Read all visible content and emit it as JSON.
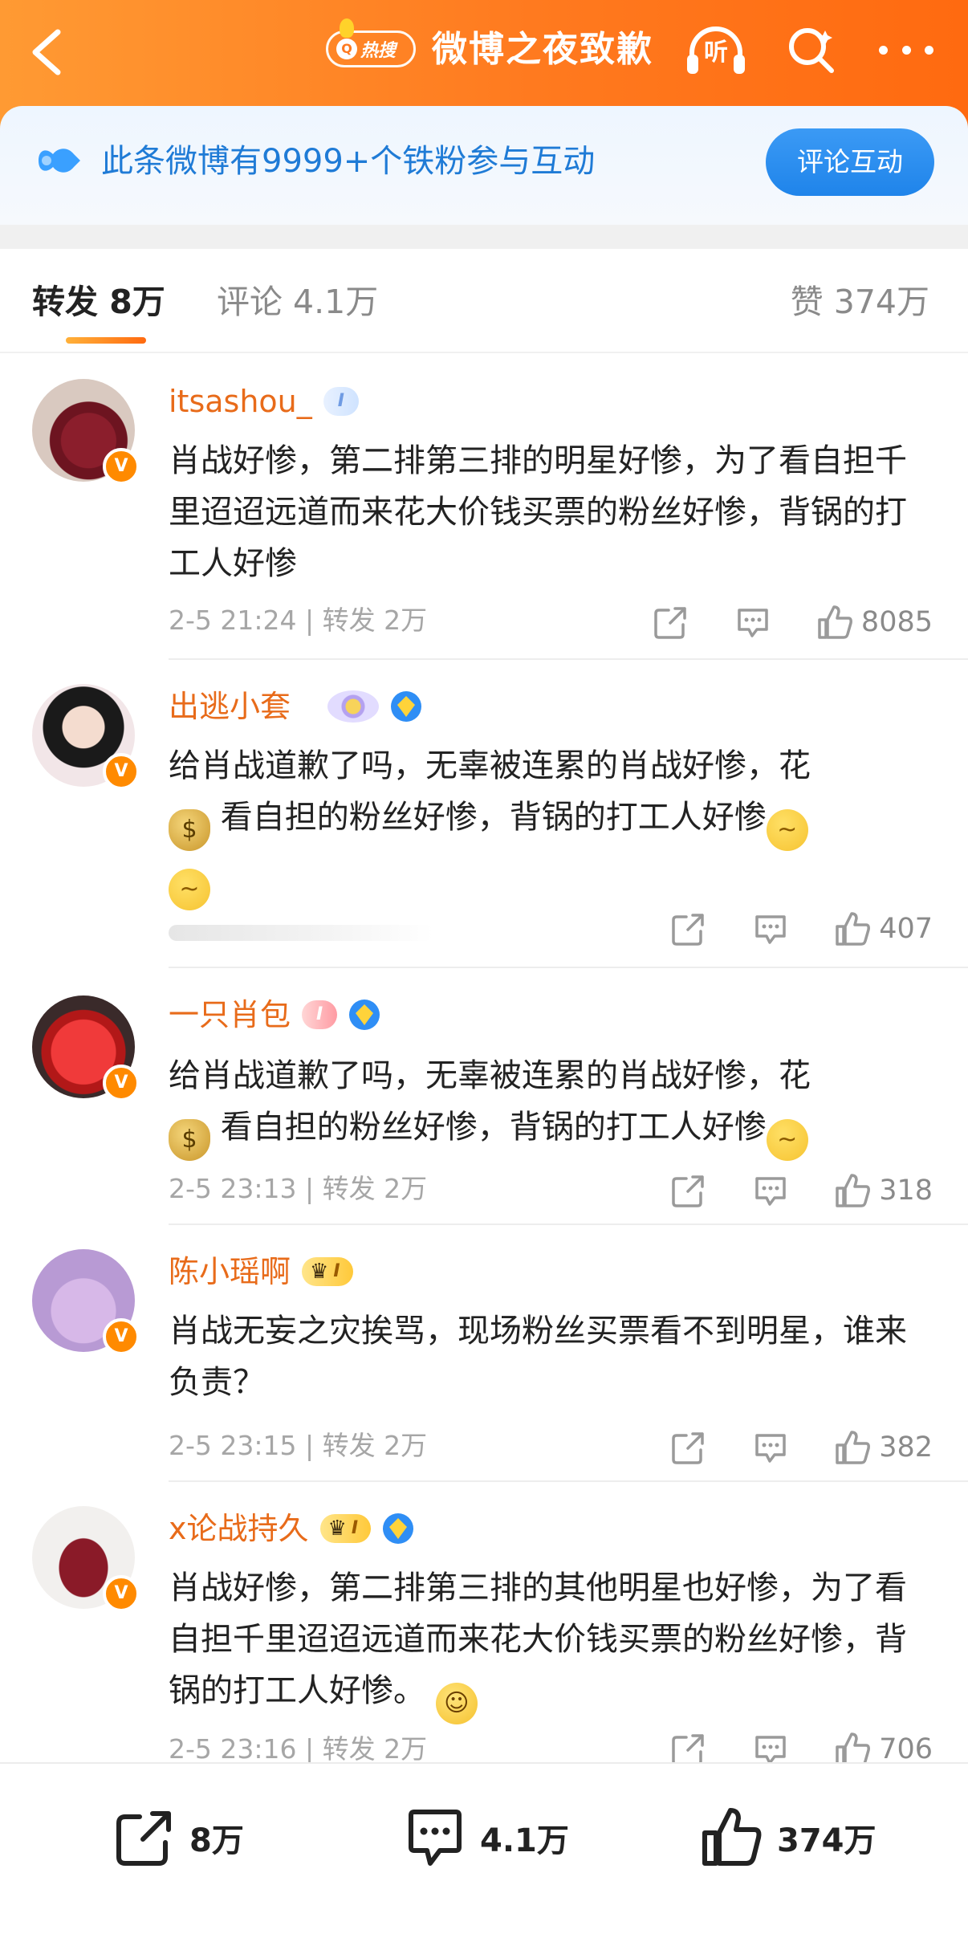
{
  "header": {
    "hot_label": "热搜",
    "title": "微博之夜致歉",
    "listen_label": "听"
  },
  "fan_banner": {
    "text": "此条微博有9999+个铁粉参与互动",
    "cta": "评论互动"
  },
  "tabs": {
    "repost": "转发 8万",
    "comment": "评论 4.1万",
    "like": "赞 374万"
  },
  "comments": [
    {
      "name": "itsashou_",
      "text": "肖战好惨，第二排第三排的明星好惨，为了看自担千里迢迢远道而来花大价钱买票的粉丝好惨，背锅的打工人好惨",
      "time": "2-5 21:24",
      "repost": "转发 2万",
      "likes": "8085",
      "badge": "I"
    },
    {
      "name": "出逃小套",
      "text_a": "给肖战道歉了吗，无辜被连累的肖战好惨，花",
      "text_b": "看自担的粉丝好惨，背锅的打工人好惨",
      "likes": "407"
    },
    {
      "name": "一只肖包",
      "text_a": "给肖战道歉了吗，无辜被连累的肖战好惨，花",
      "text_b": "看自担的粉丝好惨，背锅的打工人好惨",
      "time": "2-5 23:13",
      "repost": "转发 2万",
      "likes": "318",
      "badge": "I"
    },
    {
      "name": "陈小瑶啊",
      "text": "肖战无妄之灾挨骂，现场粉丝买票看不到明星，谁来负责？",
      "time": "2-5 23:15",
      "repost": "转发 2万",
      "likes": "382",
      "badge": "I"
    },
    {
      "name": "x论战持久",
      "text": "肖战好惨，第二排第三排的其他明星也好惨，为了看自担千里迢迢远道而来花大价钱买票的粉丝好惨，背锅的打工人好惨。",
      "time": "2-5 23:16",
      "repost": "转发 2万",
      "likes": "706",
      "badge": "I"
    }
  ],
  "meta_separator": "|",
  "bottom_bar": {
    "repost": "8万",
    "comment": "4.1万",
    "like": "374万"
  },
  "icons": {
    "back": "chevron-left-icon",
    "listen": "headphones-icon",
    "search": "search-icon",
    "more": "more-dots-icon",
    "repost": "share-icon",
    "comment": "comment-icon",
    "like": "thumbs-up-icon",
    "verified": "verified-v-icon"
  },
  "colors": {
    "header_orange": "#ff7a1f",
    "username_orange": "#e86b1a",
    "banner_blue": "#1f7bd6",
    "cta_blue": "#1f84ea",
    "meta_gray": "#a6a6a6"
  }
}
